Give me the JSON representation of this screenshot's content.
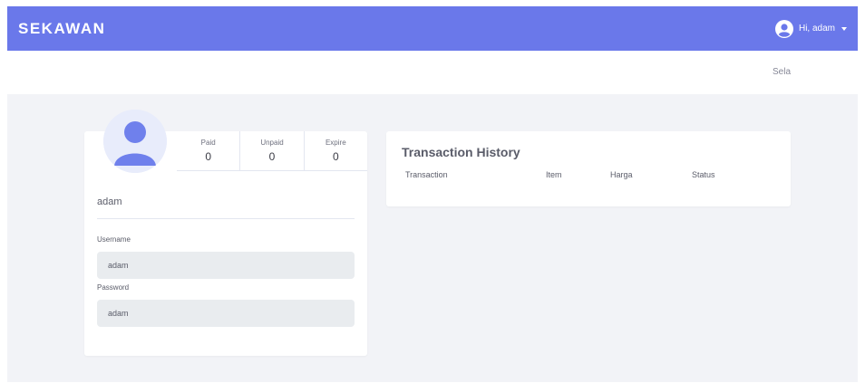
{
  "navbar": {
    "brand": "SEKAWAN",
    "user_greeting": "Hi, adam",
    "accent_color": "#6a78ea"
  },
  "subbar": {
    "text": "Sela"
  },
  "profile": {
    "stats": [
      {
        "label": "Paid",
        "value": "0"
      },
      {
        "label": "Unpaid",
        "value": "0"
      },
      {
        "label": "Expire",
        "value": "0"
      }
    ],
    "name": "adam",
    "username_label": "Username",
    "username_value": "adam",
    "password_label": "Password",
    "password_value": "adam"
  },
  "history": {
    "title": "Transaction History",
    "columns": [
      "Transaction",
      "Item",
      "Harga",
      "Status"
    ]
  },
  "icons": {
    "user_avatar": "user-circle-icon",
    "profile_avatar": "user-avatar-icon",
    "dropdown": "caret-down-icon"
  }
}
